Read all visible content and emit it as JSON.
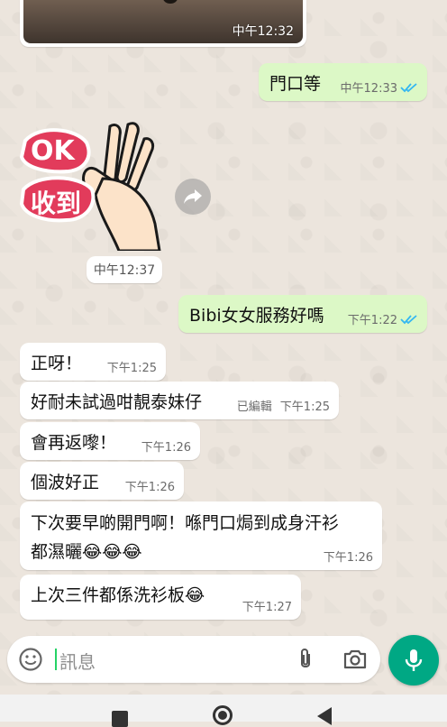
{
  "messages": {
    "image_time": "中午12:32",
    "out1": {
      "text": "門口等",
      "time": "中午12:33"
    },
    "sticker": {
      "line1": "OK",
      "line2": "收到",
      "time": "中午12:37"
    },
    "out2": {
      "text": "Bibi女女服務好嗎",
      "time": "下午1:22"
    },
    "in1": {
      "text": "正呀！",
      "time": "下午1:25"
    },
    "in2": {
      "text": "好耐未試過咁靚泰妹仔",
      "edited": "已編輯",
      "time": "下午1:25"
    },
    "in3": {
      "text": "會再返嚟！",
      "time": "下午1:26"
    },
    "in4": {
      "text": "個波好正",
      "time": "下午1:26"
    },
    "in5": {
      "line1": "下次要早啲開門啊！喺門口焗到成身汗衫",
      "line2": "都濕曬😂😂😂",
      "time": "下午1:26"
    },
    "in6": {
      "text": "上次三件都係洗衫板😂",
      "time": "下午1:27"
    }
  },
  "input": {
    "placeholder": "訊息"
  },
  "colors": {
    "outgoing": "#DCF8C6",
    "incoming": "#FFFFFF",
    "accent": "#00A884",
    "read_ticks": "#34B7F1"
  }
}
